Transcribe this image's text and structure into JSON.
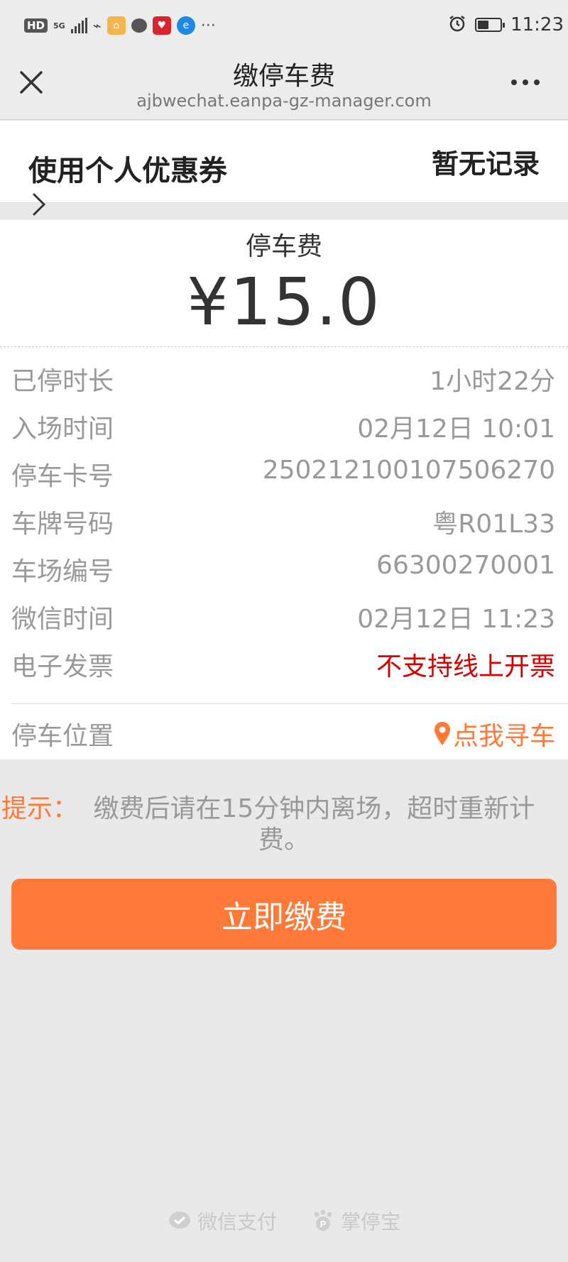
{
  "status_bar": {
    "hd": "HD",
    "network": "5G",
    "time": "11:23",
    "more": "···"
  },
  "nav": {
    "title": "缴停车费",
    "url": "ajbwechat.eanpa-gz-manager.com"
  },
  "coupon": {
    "label": "使用个人优惠券",
    "status": "暂无记录"
  },
  "fee": {
    "label": "停车费",
    "amount": "¥15.0"
  },
  "details": [
    {
      "key": "已停时长",
      "value": "1小时22分"
    },
    {
      "key": "入场时间",
      "value": "02月12日 10:01"
    },
    {
      "key": "停车卡号",
      "value": "2502121001075062​70"
    },
    {
      "key": "车牌号码",
      "value": "粤R01L33"
    },
    {
      "key": "车场编号",
      "value": "66300270001"
    },
    {
      "key": "微信时间",
      "value": "02月12日 11:23"
    },
    {
      "key": "电子发票",
      "value": "不支持线上开票"
    }
  ],
  "location": {
    "key": "停车位置",
    "link": "点我寻车"
  },
  "tip": {
    "label": "提示：",
    "line1": "缴费后请在15分钟内离场，超时重新计",
    "line2": "费。"
  },
  "pay_button": "立即缴费",
  "footer": {
    "wechat_pay": "微信支付",
    "brand": "掌停宝"
  },
  "colors": {
    "accent": "#ff7a38",
    "warning": "#d40000"
  }
}
